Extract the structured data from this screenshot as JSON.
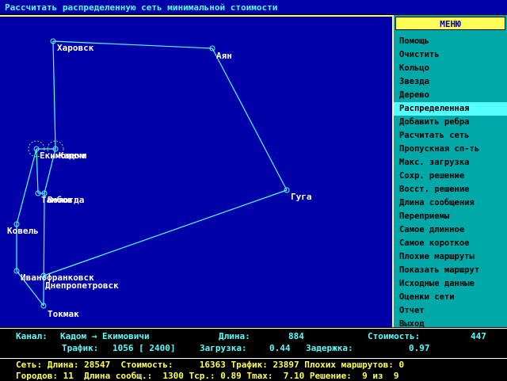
{
  "title": "Рассчитать распределенную сеть минимальной стоимости",
  "colors": {
    "map_bg": "#0000a8",
    "edge": "#55ffff",
    "menu_bg": "#00a8a8",
    "menu_active": "#55ffff",
    "header": "#ffff55"
  },
  "cities": [
    "Харовск",
    "Аян",
    "Кадом",
    "Екимовичи",
    "Тамбов",
    "Вологда",
    "Гуга",
    "Ковель",
    "Ивано­франковск",
    "Днепропетровск",
    "Токмак"
  ],
  "menu": {
    "header": "МЕНЮ",
    "items": [
      "Помощь",
      "Очистить",
      "Кольцо",
      "Звезда",
      "Дерево",
      "Распределенная",
      "Добавить ребра",
      "Расчитать сеть",
      "Пропускная сп-ть",
      "Макс. загрузка",
      "Сохр. решение",
      "Восст. решение",
      "Длина сообщения",
      "Переприемы",
      "Самое длинное",
      "Самое короткое",
      "Плохие маршруты",
      "Показать маршрут",
      "Исходные данные",
      "Оценки сети",
      "Отчет",
      "Выход"
    ],
    "active_index": 5
  },
  "channel": {
    "label": "Канал:",
    "value": "Кадом → Екимовичи",
    "length_label": "Длина:",
    "length": "884",
    "cost_label": "Стоимость:",
    "cost": "447",
    "traffic_label": "Трафик:",
    "traffic": "1056 [ 2400]",
    "load_label": "Загрузка:",
    "load": "0.44",
    "delay_label": "Задержка:",
    "delay": "0.97"
  },
  "network": {
    "line1": "Сеть: Длина: 28547  Стоимость:     16363 Трафик: 23897 Плохих маршрутов: 0",
    "line2": "Городов: 11  Длина сообщ.:  1300 Тср.: 0.89 Тmax:  7.10 Решение:  9 из  9"
  }
}
